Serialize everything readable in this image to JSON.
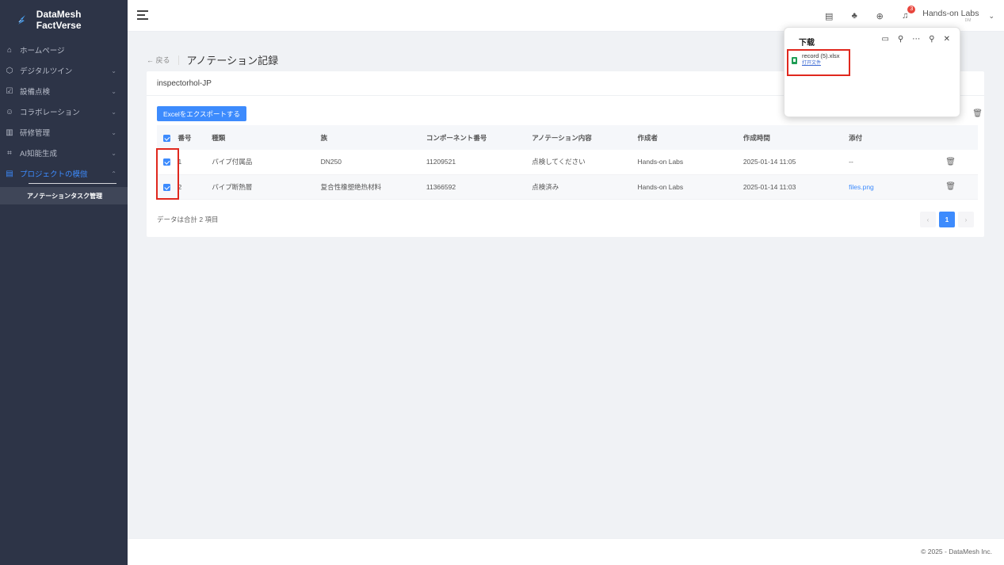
{
  "app": {
    "name": "DataMesh FactVerse"
  },
  "sidebar": {
    "items": [
      {
        "label": "ホームページ",
        "icon": "home-icon",
        "has_children": false
      },
      {
        "label": "デジタルツイン",
        "icon": "cube-icon",
        "has_children": true
      },
      {
        "label": "設備点検",
        "icon": "checklist-icon",
        "has_children": true
      },
      {
        "label": "コラボレーション",
        "icon": "people-icon",
        "has_children": true
      },
      {
        "label": "研修管理",
        "icon": "book-icon",
        "has_children": true
      },
      {
        "label": "AI知能生成",
        "icon": "ai-icon",
        "has_children": true
      },
      {
        "label": "プロジェクトの模倣",
        "icon": "calendar-icon",
        "has_children": true,
        "active": true
      }
    ],
    "sub_item": "アノテーションタスク管理"
  },
  "header": {
    "notifications_count": "3",
    "user_name": "Hands-on Labs",
    "user_sub": "DM"
  },
  "breadcrumb": {
    "back": "← 戻る",
    "title": "アノテーション記録"
  },
  "card": {
    "heading": "inspectorhol-JP",
    "export_label": "Excelをエクスポートする",
    "columns": [
      "番号",
      "種類",
      "族",
      "コンポーネント番号",
      "アノテーション内容",
      "作成者",
      "作成時間",
      "添付"
    ],
    "rows": [
      {
        "no": "1",
        "type": "パイプ付属品",
        "family": "DN250",
        "component": "11209521",
        "content": "点検してください",
        "creator": "Hands-on Labs",
        "time": "2025-01-14 11:05",
        "attachment": "--",
        "checked": true
      },
      {
        "no": "2",
        "type": "パイプ断熱層",
        "family": "复合性橡塑绝热材料",
        "component": "11366592",
        "content": "点検済み",
        "creator": "Hands-on Labs",
        "time": "2025-01-14 11:03",
        "attachment": "files.png",
        "checked": true
      }
    ],
    "total": "データは合計 2 項目",
    "pager": {
      "prev": "‹",
      "current": "1",
      "next": "›"
    }
  },
  "download": {
    "title": "下载",
    "file_name": "record (5).xlsx",
    "open_label": "打开文件"
  },
  "footer": {
    "copyright": "© 2025 - DataMesh Inc."
  },
  "colors": {
    "accent": "#3d8bfd",
    "sidebar": "#2d3447",
    "highlight": "#e0281e"
  }
}
